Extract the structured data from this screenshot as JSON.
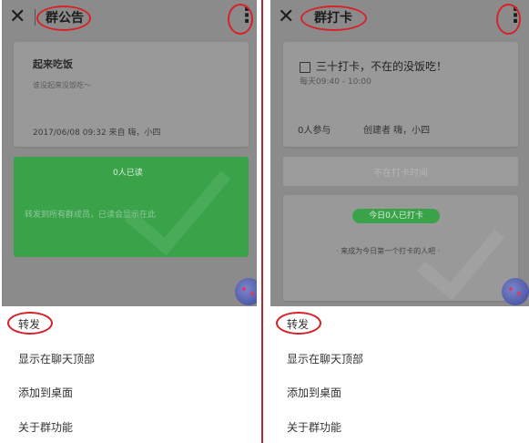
{
  "left": {
    "title": "群公告",
    "notice": {
      "headline": "起来吃饭",
      "body": "谁没起来没饭吃～",
      "meta": "2017/06/08 09:32 来自 嗨，小四"
    },
    "read_status": {
      "count": "0人已读",
      "hint": "转发到所有群成员，已读会显示在此"
    },
    "menu": [
      "转发",
      "显示在聊天顶部",
      "添加到桌面",
      "关于群功能"
    ]
  },
  "right": {
    "title": "群打卡",
    "checkin": {
      "headline": "三十打卡，不在的没饭吃！",
      "time": "每天09:40 - 10:00",
      "participants": "0人参与",
      "creator": "创建者 嗨，小四"
    },
    "button_disabled": "不在打卡时间",
    "today_badge": "今日0人已打卡",
    "empty_hint": "· 来成为今日第一个打卡的人吧 ·",
    "menu": [
      "转发",
      "显示在聊天顶部",
      "添加到桌面",
      "关于群功能"
    ]
  },
  "colors": {
    "accent_green": "#3aa34a",
    "annotation_red": "#d6222a",
    "overlay_gray": "#8b8b8b"
  },
  "icons": {
    "close": "close-icon",
    "more": "more-vertical-icon",
    "checkbox": "checkbox-icon",
    "avatar": "avatar"
  }
}
